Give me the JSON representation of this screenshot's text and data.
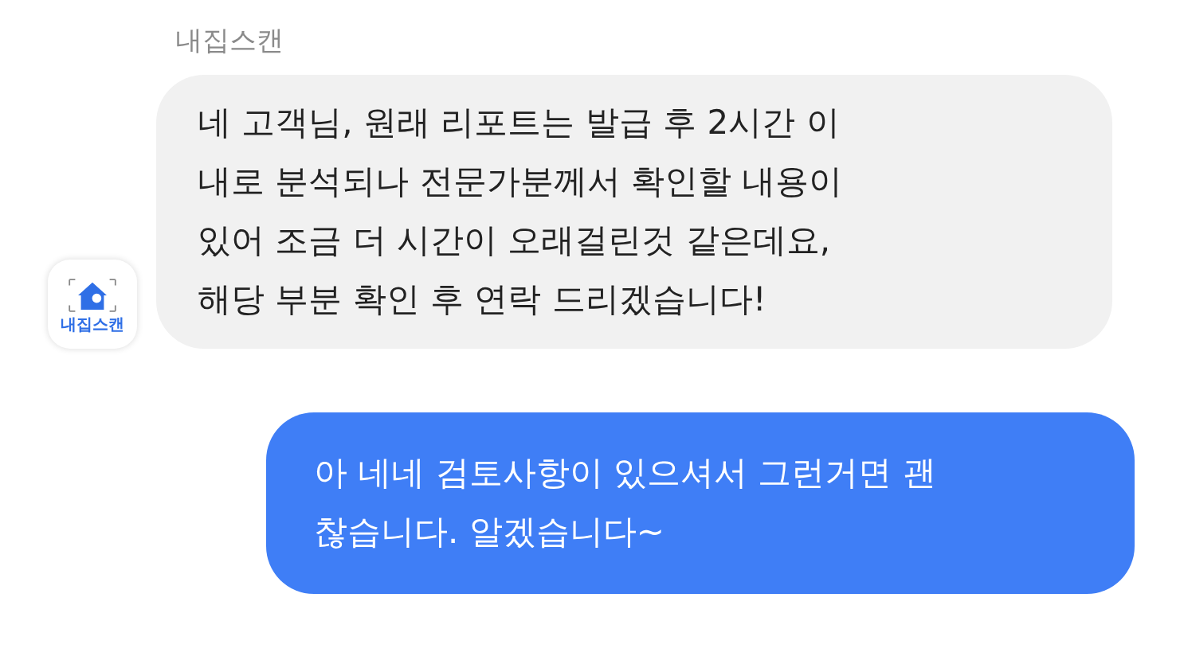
{
  "messages": [
    {
      "kind": "incoming",
      "sender": "내집스캔",
      "avatar_label": "내집스캔",
      "text": "네 고객님, 원래 리포트는 발급 후 2시간 이\n내로 분석되나 전문가분께서 확인할 내용이\n있어 조금 더 시간이 오래걸린것 같은데요,\n해당 부분 확인 후 연락 드리겠습니다!"
    },
    {
      "kind": "outgoing",
      "text": "아 네네 검토사항이 있으셔서 그런거면 괜\n찮습니다. 알겠습니다~"
    }
  ]
}
